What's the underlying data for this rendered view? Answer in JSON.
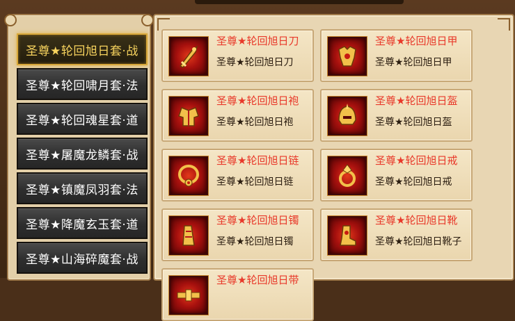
{
  "sets": [
    {
      "label": "圣尊★轮回旭日套·战",
      "active": true
    },
    {
      "label": "圣尊★轮回啸月套·法",
      "active": false
    },
    {
      "label": "圣尊★轮回魂星套·道",
      "active": false
    },
    {
      "label": "圣尊★屠魔龙鳞套·战",
      "active": false
    },
    {
      "label": "圣尊★镇魔凤羽套·法",
      "active": false
    },
    {
      "label": "圣尊★降魔玄玉套·道",
      "active": false
    },
    {
      "label": "圣尊★山海碎魔套·战",
      "active": false
    }
  ],
  "items": [
    {
      "title": "圣尊★轮回旭日刀",
      "sub": "圣尊★轮回旭日刀",
      "icon": "sword-icon"
    },
    {
      "title": "圣尊★轮回旭日甲",
      "sub": "圣尊★轮回旭日甲",
      "icon": "armor-icon"
    },
    {
      "title": "圣尊★轮回旭日袍",
      "sub": "圣尊★轮回旭日袍",
      "icon": "robe-icon"
    },
    {
      "title": "圣尊★轮回旭日盔",
      "sub": "圣尊★轮回旭日盔",
      "icon": "helmet-icon"
    },
    {
      "title": "圣尊★轮回旭日链",
      "sub": "圣尊★轮回旭日链",
      "icon": "necklace-icon"
    },
    {
      "title": "圣尊★轮回旭日戒",
      "sub": "圣尊★轮回旭日戒",
      "icon": "ring-icon"
    },
    {
      "title": "圣尊★轮回旭日镯",
      "sub": "圣尊★轮回旭日镯",
      "icon": "bracelet-icon"
    },
    {
      "title": "圣尊★轮回旭日靴",
      "sub": "圣尊★轮回旭日靴子",
      "icon": "boots-icon"
    },
    {
      "title": "圣尊★轮回旭日带",
      "sub": "",
      "icon": "belt-icon"
    }
  ],
  "colors": {
    "active_text": "#f7d35e",
    "item_title": "#e8392a",
    "item_sub": "#2b1d10"
  }
}
